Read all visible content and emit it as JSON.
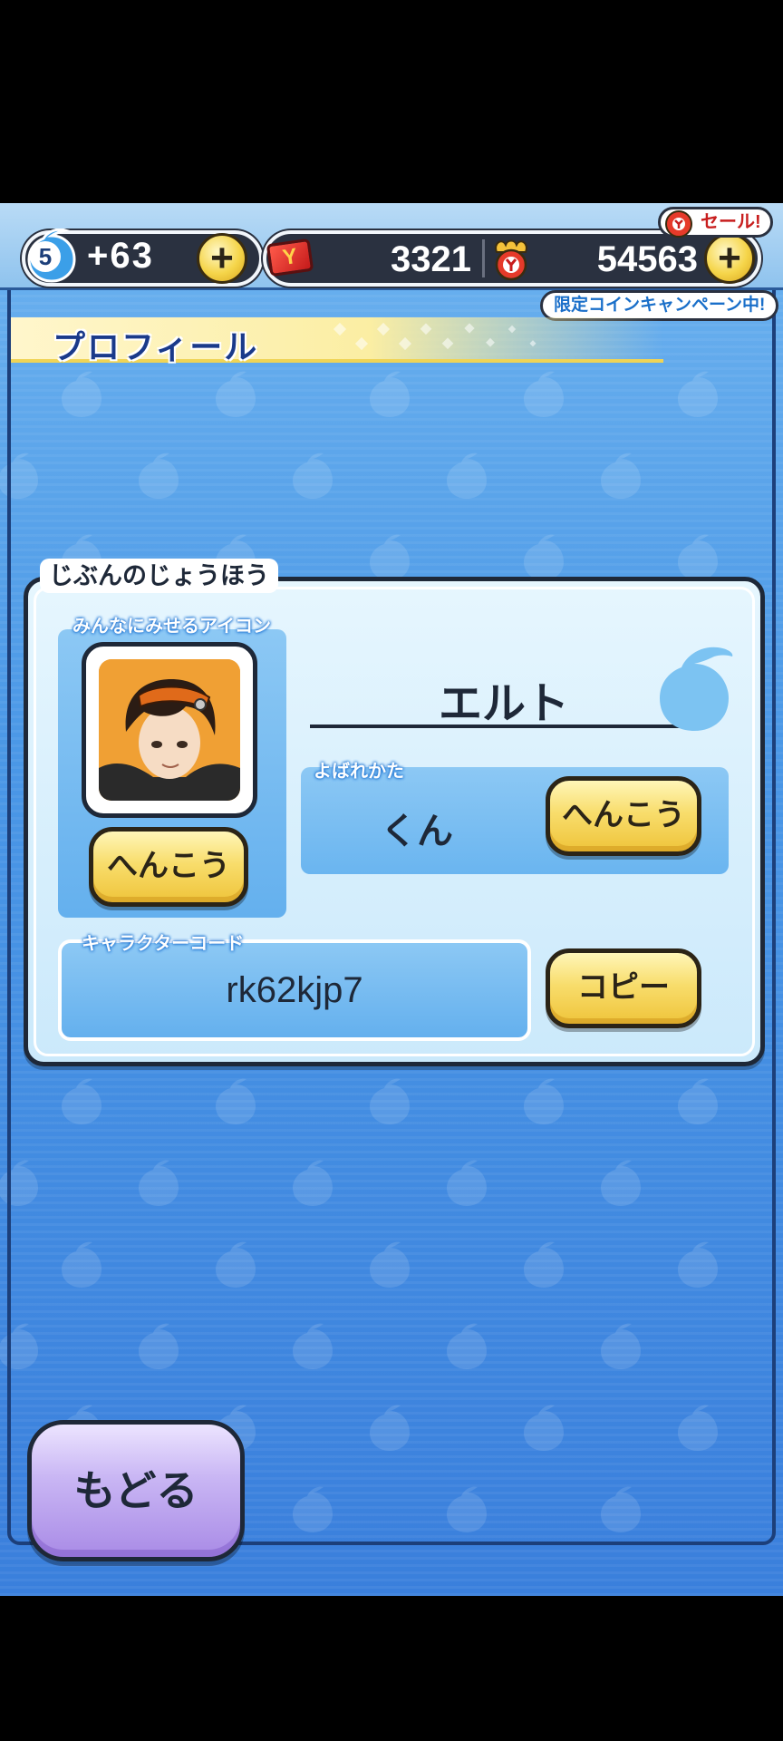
{
  "hud": {
    "stamina_level": "5",
    "stamina_bonus": "+63",
    "plus": "+",
    "ticket_count": "3321",
    "coin_count": "54563",
    "sale_label": "セール!",
    "campaign_label": "限定コインキャンペーン中!"
  },
  "page": {
    "title": "プロフィール"
  },
  "profile": {
    "section_title": "じぶんのじょうほう",
    "icon_label": "みんなにみせるアイコン",
    "change_icon_button": "へんこう",
    "name": "エルト",
    "title_label": "よばれかた",
    "title_value": "くん",
    "change_title_button": "へんこう",
    "code_label": "キャラクターコード",
    "code_value": "rk62kjp7",
    "copy_button": "コピー"
  },
  "footer": {
    "back_button": "もどる"
  },
  "colors": {
    "background": "#3f86e0",
    "button_yellow": "#f8dd6c",
    "button_purple": "#c9b6f4",
    "title_text": "#1a3a8a"
  },
  "icons": [
    "stamina-drop-icon",
    "ticket-icon",
    "coin-icon",
    "plus-icon",
    "drop-deco-icon"
  ]
}
